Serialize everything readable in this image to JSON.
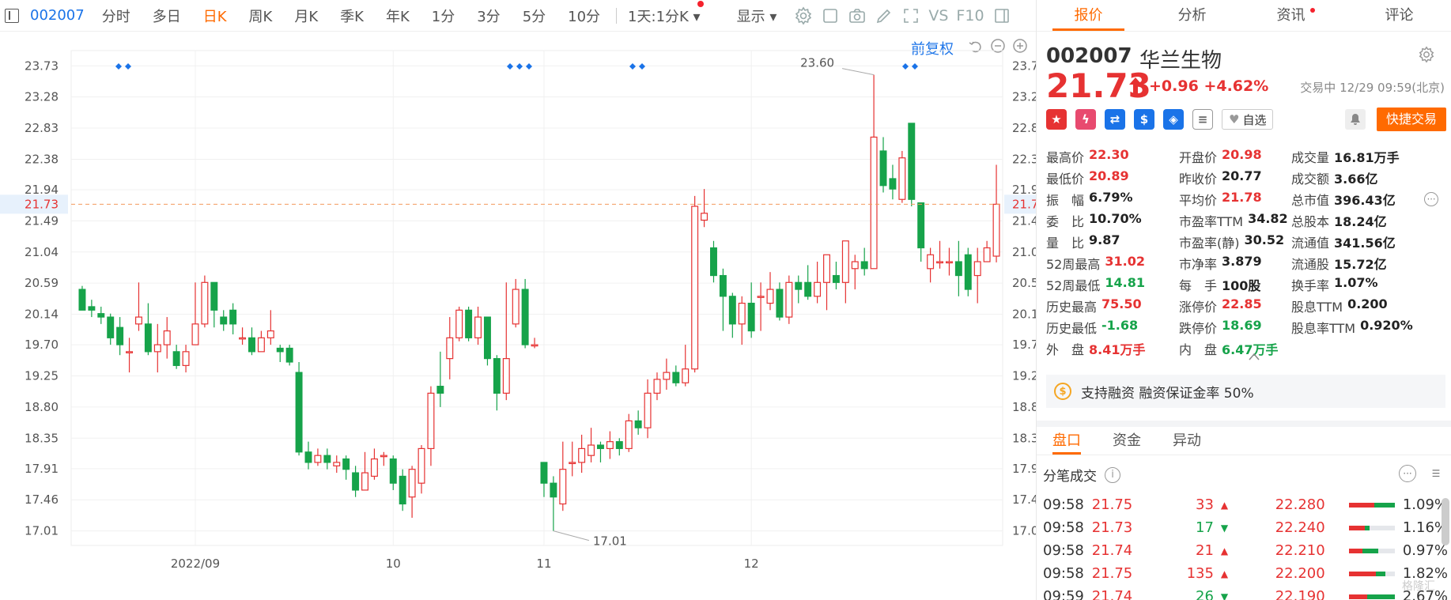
{
  "toolbar": {
    "code": "002007",
    "tabs": [
      "分时",
      "多日",
      "日K",
      "周K",
      "月K",
      "季K",
      "年K",
      "1分",
      "3分",
      "5分",
      "10分"
    ],
    "active": "日K",
    "period": "1天:1分K",
    "display": "显示",
    "vs": "VS",
    "f10": "F10"
  },
  "chart_header": {
    "fq": "前复权"
  },
  "right": {
    "tabs": [
      "报价",
      "分析",
      "资讯",
      "评论"
    ],
    "code": "002007",
    "name": "华兰生物",
    "price": "21.73",
    "change": "+0.96",
    "pct": "+4.62%",
    "status": "交易中 12/29 09:59(北京)",
    "zixuan": "自选",
    "quick_trade": "快捷交易",
    "stats": [
      [
        {
          "k": "最高价",
          "v": "22.30",
          "c": "r"
        },
        {
          "k": "开盘价",
          "v": "20.98",
          "c": "r"
        },
        {
          "k": "成交量",
          "v": "16.81万手",
          "c": "n"
        }
      ],
      [
        {
          "k": "最低价",
          "v": "20.89",
          "c": "r"
        },
        {
          "k": "昨收价",
          "v": "20.77",
          "c": "n"
        },
        {
          "k": "成交额",
          "v": "3.66亿",
          "c": "n"
        }
      ],
      [
        {
          "k": "振　幅",
          "v": "6.79%",
          "c": "n"
        },
        {
          "k": "平均价",
          "v": "21.78",
          "c": "r"
        },
        {
          "k": "总市值",
          "v": "396.43亿",
          "c": "n"
        }
      ],
      [
        {
          "k": "委　比",
          "v": "10.70%",
          "c": "n"
        },
        {
          "k": "市盈率TTM",
          "v": "34.82",
          "c": "n"
        },
        {
          "k": "总股本",
          "v": "18.24亿",
          "c": "n"
        }
      ],
      [
        {
          "k": "量　比",
          "v": "9.87",
          "c": "n"
        },
        {
          "k": "市盈率(静)",
          "v": "30.52",
          "c": "n"
        },
        {
          "k": "流通值",
          "v": "341.56亿",
          "c": "n"
        }
      ],
      [
        {
          "k": "52周最高",
          "v": "31.02",
          "c": "r"
        },
        {
          "k": "市净率",
          "v": "3.879",
          "c": "n"
        },
        {
          "k": "流通股",
          "v": "15.72亿",
          "c": "n"
        }
      ],
      [
        {
          "k": "52周最低",
          "v": "14.81",
          "c": "g"
        },
        {
          "k": "每　手",
          "v": "100股",
          "c": "n"
        },
        {
          "k": "换手率",
          "v": "1.07%",
          "c": "n"
        }
      ],
      [
        {
          "k": "历史最高",
          "v": "75.50",
          "c": "r"
        },
        {
          "k": "涨停价",
          "v": "22.85",
          "c": "r"
        },
        {
          "k": "股息TTM",
          "v": "0.200",
          "c": "n"
        }
      ],
      [
        {
          "k": "历史最低",
          "v": "-1.68",
          "c": "g"
        },
        {
          "k": "跌停价",
          "v": "18.69",
          "c": "g"
        },
        {
          "k": "股息率TTM",
          "v": "0.920%",
          "c": "n"
        }
      ],
      [
        {
          "k": "外　盘",
          "v": "8.41万手",
          "c": "r"
        },
        {
          "k": "内　盘",
          "v": "6.47万手",
          "c": "g"
        }
      ]
    ],
    "margin": "支持融资 融资保证金率 50%",
    "bottom_tabs": [
      "盘口",
      "资金",
      "异动"
    ],
    "ticks_title": "分笔成交",
    "ticks": [
      {
        "time": "09:58",
        "price": "21.75",
        "vol": "33",
        "dir": "up",
        "amt": "22.280",
        "pct": "1.09%",
        "red": 0.55,
        "green": 0.45
      },
      {
        "time": "09:58",
        "price": "21.73",
        "vol": "17",
        "dir": "down",
        "amt": "22.240",
        "pct": "1.16%",
        "red": 0.35,
        "green": 0.1
      },
      {
        "time": "09:58",
        "price": "21.74",
        "vol": "21",
        "dir": "up",
        "amt": "22.210",
        "pct": "0.97%",
        "red": 0.3,
        "green": 0.35
      },
      {
        "time": "09:58",
        "price": "21.75",
        "vol": "135",
        "dir": "up",
        "amt": "22.200",
        "pct": "1.82%",
        "red": 0.6,
        "green": 0.2
      },
      {
        "time": "09:59",
        "price": "21.74",
        "vol": "26",
        "dir": "down",
        "amt": "22.190",
        "pct": "2.67%",
        "red": 0.4,
        "green": 0.6
      }
    ],
    "watermark": "格隆汇"
  },
  "chart_data": {
    "type": "candlestick",
    "title": "",
    "ylim": [
      16.8,
      23.95
    ],
    "yticks": [
      17.01,
      17.46,
      17.91,
      18.35,
      18.8,
      19.25,
      19.7,
      20.14,
      20.59,
      21.04,
      21.49,
      21.94,
      22.38,
      22.83,
      23.28,
      23.73
    ],
    "xlabels": [
      {
        "i": 12,
        "label": "2022/09"
      },
      {
        "i": 33,
        "label": "10"
      },
      {
        "i": 49,
        "label": "11"
      },
      {
        "i": 71,
        "label": "12"
      }
    ],
    "last_price": 21.73,
    "max_label": "23.60",
    "min_label": "17.01",
    "candles": [
      [
        20.5,
        20.2,
        20.55,
        20.2
      ],
      [
        20.25,
        20.2,
        20.35,
        20.1
      ],
      [
        20.15,
        20.1,
        20.25,
        20.0
      ],
      [
        20.1,
        19.8,
        20.15,
        19.7
      ],
      [
        19.95,
        19.7,
        20.1,
        19.55
      ],
      [
        19.6,
        19.6,
        19.8,
        19.3
      ],
      [
        20.0,
        20.1,
        20.6,
        19.9
      ],
      [
        20.0,
        19.6,
        20.3,
        19.55
      ],
      [
        19.6,
        19.7,
        20.0,
        19.3
      ],
      [
        19.7,
        19.9,
        20.1,
        19.5
      ],
      [
        19.6,
        19.4,
        19.7,
        19.35
      ],
      [
        19.4,
        19.6,
        19.7,
        19.3
      ],
      [
        19.7,
        20.0,
        20.6,
        19.7
      ],
      [
        20.0,
        20.6,
        20.7,
        19.95
      ],
      [
        20.6,
        20.2,
        20.6,
        19.95
      ],
      [
        20.1,
        20.0,
        20.2,
        19.9
      ],
      [
        20.2,
        20.0,
        20.3,
        19.85
      ],
      [
        19.8,
        19.8,
        19.95,
        19.7
      ],
      [
        19.8,
        19.6,
        19.95,
        19.55
      ],
      [
        19.6,
        19.8,
        19.9,
        19.6
      ],
      [
        19.8,
        19.9,
        20.2,
        19.7
      ],
      [
        19.65,
        19.6,
        19.7,
        19.45
      ],
      [
        19.65,
        19.45,
        19.7,
        19.4
      ],
      [
        19.3,
        18.15,
        19.45,
        18.1
      ],
      [
        18.15,
        18.0,
        18.3,
        17.9
      ],
      [
        18.0,
        18.1,
        18.2,
        17.95
      ],
      [
        18.1,
        18.0,
        18.2,
        17.9
      ],
      [
        17.95,
        18.0,
        18.1,
        17.85
      ],
      [
        18.05,
        17.9,
        18.1,
        17.75
      ],
      [
        17.85,
        17.6,
        17.95,
        17.5
      ],
      [
        17.6,
        17.85,
        18.15,
        17.6
      ],
      [
        17.8,
        18.05,
        18.2,
        17.75
      ],
      [
        18.1,
        18.1,
        18.15,
        17.95
      ],
      [
        18.05,
        17.7,
        18.1,
        17.6
      ],
      [
        17.8,
        17.4,
        17.9,
        17.3
      ],
      [
        17.5,
        17.9,
        17.95,
        17.2
      ],
      [
        17.7,
        18.2,
        18.25,
        17.55
      ],
      [
        18.2,
        19.0,
        19.1,
        17.95
      ],
      [
        19.1,
        19.0,
        19.6,
        18.8
      ],
      [
        19.5,
        19.8,
        20.1,
        19.2
      ],
      [
        19.8,
        20.2,
        20.25,
        19.75
      ],
      [
        20.2,
        19.8,
        20.25,
        19.75
      ],
      [
        19.8,
        20.1,
        20.25,
        19.7
      ],
      [
        20.1,
        19.5,
        20.1,
        19.4
      ],
      [
        19.5,
        19.0,
        19.55,
        18.75
      ],
      [
        19.0,
        19.5,
        20.6,
        18.9
      ],
      [
        20.0,
        20.5,
        20.65,
        19.95
      ],
      [
        20.5,
        19.7,
        20.65,
        19.65
      ],
      [
        19.7,
        19.7,
        19.8,
        19.65
      ],
      [
        18.0,
        17.7,
        18.0,
        17.5
      ],
      [
        17.7,
        17.5,
        17.8,
        17.01
      ],
      [
        17.4,
        17.9,
        18.3,
        17.3
      ],
      [
        18.0,
        18.0,
        18.3,
        17.8
      ],
      [
        18.0,
        18.2,
        18.4,
        17.85
      ],
      [
        18.1,
        18.25,
        18.5,
        18.0
      ],
      [
        18.25,
        18.2,
        18.3,
        18.0
      ],
      [
        18.2,
        18.3,
        18.45,
        18.05
      ],
      [
        18.3,
        18.2,
        18.35,
        18.1
      ],
      [
        18.2,
        18.6,
        18.7,
        18.15
      ],
      [
        18.6,
        18.5,
        18.75,
        18.4
      ],
      [
        18.5,
        19.0,
        19.2,
        18.35
      ],
      [
        19.0,
        19.2,
        19.3,
        18.9
      ],
      [
        19.2,
        19.3,
        19.5,
        19.05
      ],
      [
        19.3,
        19.15,
        19.4,
        19.1
      ],
      [
        19.15,
        19.35,
        19.7,
        19.1
      ],
      [
        19.35,
        21.7,
        21.85,
        19.3
      ],
      [
        21.5,
        21.6,
        21.95,
        21.4
      ],
      [
        21.1,
        20.7,
        21.2,
        20.6
      ],
      [
        20.7,
        20.4,
        20.8,
        19.9
      ],
      [
        20.4,
        20.0,
        20.45,
        19.8
      ],
      [
        20.0,
        20.3,
        20.4,
        19.7
      ],
      [
        20.3,
        19.9,
        20.6,
        19.8
      ],
      [
        20.4,
        20.4,
        20.6,
        19.9
      ],
      [
        20.3,
        20.5,
        20.75,
        20.2
      ],
      [
        20.5,
        20.1,
        20.6,
        20.05
      ],
      [
        20.1,
        20.6,
        20.7,
        20.0
      ],
      [
        20.6,
        20.5,
        20.7,
        20.3
      ],
      [
        20.6,
        20.4,
        20.85,
        20.35
      ],
      [
        20.4,
        20.6,
        20.9,
        20.3
      ],
      [
        20.6,
        21.0,
        21.0,
        20.2
      ],
      [
        20.7,
        20.6,
        20.9,
        20.5
      ],
      [
        20.6,
        21.2,
        21.2,
        20.3
      ],
      [
        20.8,
        20.9,
        21.0,
        20.5
      ],
      [
        20.9,
        20.8,
        21.1,
        20.7
      ],
      [
        20.8,
        22.7,
        23.6,
        20.8
      ],
      [
        22.5,
        22.0,
        22.7,
        21.9
      ],
      [
        22.1,
        21.95,
        22.3,
        21.8
      ],
      [
        21.8,
        22.4,
        22.5,
        21.75
      ],
      [
        22.9,
        21.8,
        22.9,
        21.7
      ],
      [
        21.75,
        21.1,
        21.75,
        20.9
      ],
      [
        20.8,
        21.0,
        21.1,
        20.6
      ],
      [
        20.9,
        20.9,
        21.2,
        20.8
      ],
      [
        20.9,
        20.9,
        21.1,
        20.7
      ],
      [
        20.9,
        20.7,
        21.2,
        20.4
      ],
      [
        21.0,
        20.5,
        21.1,
        20.4
      ],
      [
        20.7,
        20.9,
        21.1,
        20.3
      ],
      [
        20.9,
        21.1,
        21.2,
        20.9
      ],
      [
        20.98,
        21.73,
        22.3,
        20.89
      ]
    ]
  }
}
